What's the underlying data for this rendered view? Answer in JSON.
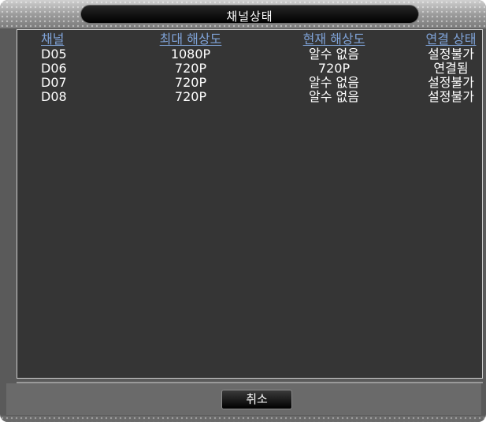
{
  "dialog": {
    "title": "채널상태",
    "cancel_label": "취소"
  },
  "table": {
    "headers": [
      "채널",
      "최대 해상도",
      "현재 해상도",
      "연결 상태"
    ],
    "rows": [
      [
        "D05",
        "1080P",
        "알수 없음",
        "설정불가"
      ],
      [
        "D06",
        "720P",
        "720P",
        "연결됨"
      ],
      [
        "D07",
        "720P",
        "알수 없음",
        "설정불가"
      ],
      [
        "D08",
        "720P",
        "알수 없음",
        "설정불가"
      ]
    ]
  },
  "colors": {
    "header_text": "#7fa3d8",
    "panel_bg": "#353535",
    "cell_text": "#ffffff"
  }
}
